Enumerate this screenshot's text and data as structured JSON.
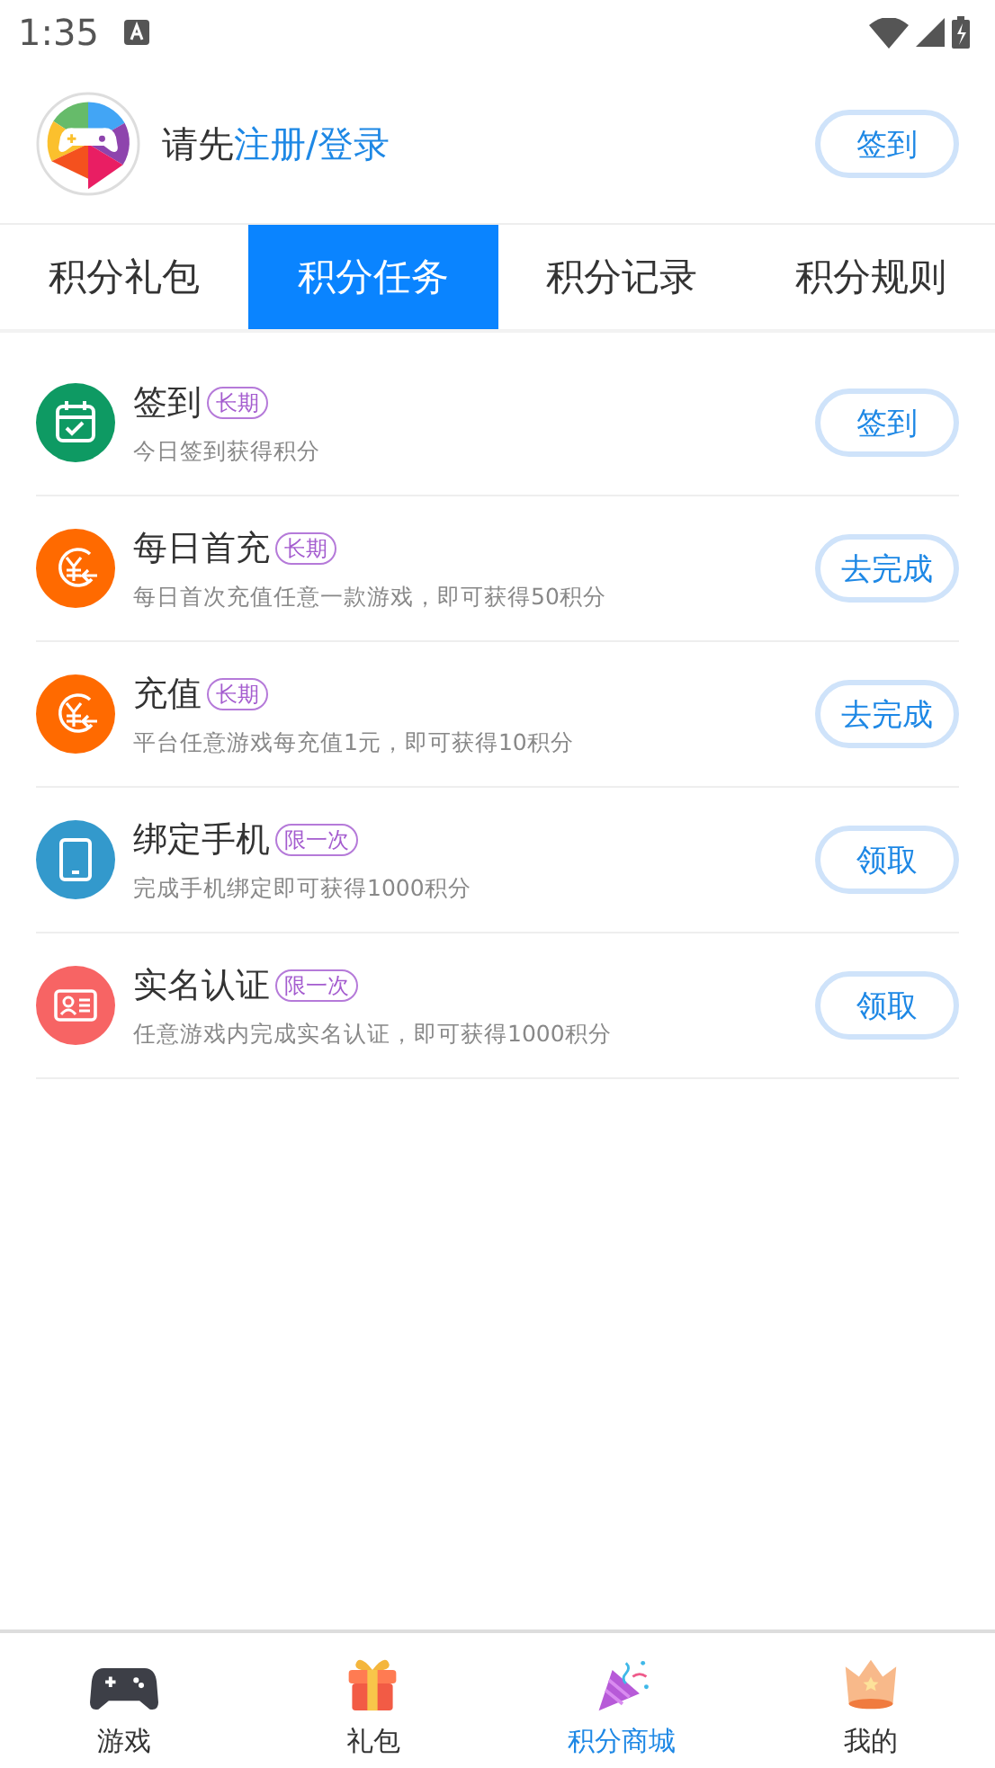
{
  "status_bar": {
    "time": "1:35"
  },
  "header": {
    "prompt": "请先",
    "login_link": "注册/登录",
    "checkin_button": "签到"
  },
  "tabs": [
    {
      "label": "积分礼包",
      "selected": false
    },
    {
      "label": "积分任务",
      "selected": true
    },
    {
      "label": "积分记录",
      "selected": false
    },
    {
      "label": "积分规则",
      "selected": false
    }
  ],
  "tasks": [
    {
      "kind": "calendar",
      "title": "签到",
      "tag": "长期",
      "description": "今日签到获得积分",
      "button": "签到"
    },
    {
      "kind": "recharge",
      "title": "每日首充",
      "tag": "长期",
      "description": "每日首次充值任意一款游戏，即可获得50积分",
      "button": "去完成"
    },
    {
      "kind": "recharge",
      "title": "充值",
      "tag": "长期",
      "description": "平台任意游戏每充值1元，即可获得10积分",
      "button": "去完成"
    },
    {
      "kind": "phone",
      "title": "绑定手机",
      "tag": "限一次",
      "description": "完成手机绑定即可获得1000积分",
      "button": "领取"
    },
    {
      "kind": "idcard",
      "title": "实名认证",
      "tag": "限一次",
      "description": "任意游戏内完成实名认证，即可获得1000积分",
      "button": "领取"
    }
  ],
  "bottom_nav": [
    {
      "kind": "gamepad",
      "label": "游戏",
      "selected": false
    },
    {
      "kind": "gift",
      "label": "礼包",
      "selected": false
    },
    {
      "kind": "party",
      "label": "积分商城",
      "selected": true
    },
    {
      "kind": "crown",
      "label": "我的",
      "selected": false
    }
  ]
}
